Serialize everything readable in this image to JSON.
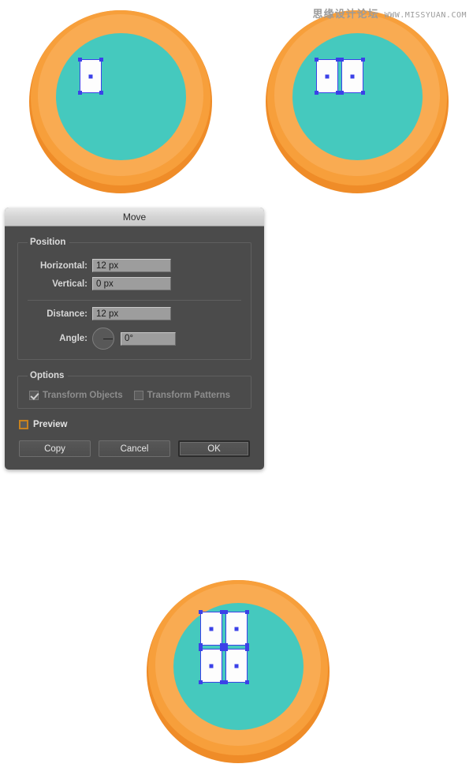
{
  "watermark": {
    "cn_text": "思缘设计论坛",
    "url_text": "WWW.MISSYUAN.COM"
  },
  "illustration": {
    "colors": {
      "ring_dark": "#ef8c28",
      "ring_mid": "#f79f3b",
      "ring_highlight": "#f9ab52",
      "inner_teal": "#45c9be",
      "selection_blue": "#3b41e8",
      "shape_fill": "#fdfdfd"
    },
    "steps": [
      {
        "name": "step-1-single-rect",
        "rect_count": 1
      },
      {
        "name": "step-2-two-rects",
        "rect_count": 2
      },
      {
        "name": "step-3-four-rects",
        "rect_count": 4
      }
    ]
  },
  "dialog": {
    "title": "Move",
    "position_group": {
      "legend": "Position",
      "fields": [
        {
          "label": "Horizontal:",
          "value": "12 px"
        },
        {
          "label": "Vertical:",
          "value": "0 px"
        },
        {
          "label": "Distance:",
          "value": "12 px"
        },
        {
          "label": "Angle:",
          "value": "0°"
        }
      ]
    },
    "options_group": {
      "legend": "Options",
      "checkboxes": [
        {
          "label": "Transform Objects",
          "checked": true,
          "enabled": false
        },
        {
          "label": "Transform Patterns",
          "checked": false,
          "enabled": false
        }
      ]
    },
    "preview": {
      "label": "Preview",
      "checked": false,
      "focused": true
    },
    "buttons": [
      {
        "label": "Copy",
        "default": false
      },
      {
        "label": "Cancel",
        "default": false
      },
      {
        "label": "OK",
        "default": true
      }
    ]
  }
}
